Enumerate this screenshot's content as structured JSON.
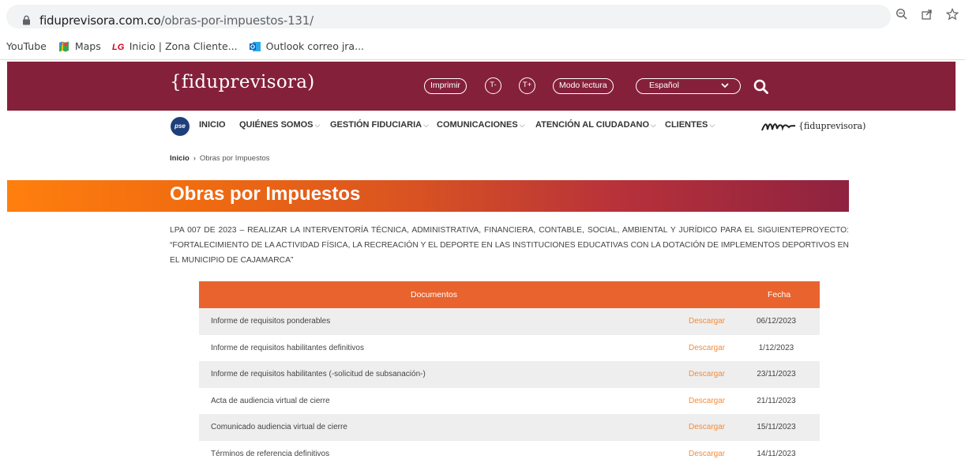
{
  "browser": {
    "url_host": "fiduprevisora.com.co",
    "url_path": "/obras-por-impuestos-131/",
    "icons": [
      "zoom-icon",
      "share-icon",
      "bookmark-star-icon"
    ]
  },
  "bookmarks": [
    {
      "label": "YouTube"
    },
    {
      "label": "Maps"
    },
    {
      "label": "Inicio | Zona Cliente..."
    },
    {
      "label": "Outlook correo jra..."
    }
  ],
  "header": {
    "logo": "{fiduprevisora)",
    "print_label": "Imprimir",
    "text_decrease": "T-",
    "text_increase": "T+",
    "reading_mode": "Modo lectura",
    "language": "Español",
    "colors": {
      "brand": "#85203b",
      "accent": "#e8632d"
    }
  },
  "nav": {
    "pse": "pse",
    "items": [
      "INICIO",
      "QUIÉNES SOMOS",
      "GESTIÓN FIDUCIARIA",
      "COMUNICACIONES",
      "ATENCIÓN AL CIUDADANO",
      "CLIENTES"
    ],
    "signature_text": "{fiduprevisora)"
  },
  "breadcrumb": {
    "home": "Inicio",
    "current": "Obras por Impuestos"
  },
  "page": {
    "title": "Obras por Impuestos",
    "description": "LPA 007 DE 2023 – REALIZAR LA INTERVENTORÍA TÉCNICA, ADMINISTRATIVA, FINANCIERA, CONTABLE, SOCIAL, AMBIENTAL Y JURÍDICO PARA EL SIGUIENTEPROYECTO: “FORTALECIMIENTO DE LA ACTIVIDAD FÍSICA, LA RECREACIÓN Y EL DEPORTE EN LAS INSTITUCIONES EDUCATIVAS CON LA DOTACIÓN DE IMPLEMENTOS DEPORTIVOS EN EL MUNICIPIO DE CAJAMARCA”"
  },
  "table": {
    "headers": {
      "documents": "Documentos",
      "date": "Fecha"
    },
    "rows": [
      {
        "name": "Informe de requisitos ponderables",
        "action": "Descargar",
        "date": "06/12/2023"
      },
      {
        "name": "Informe de requisitos habilitantes definitivos",
        "action": "Descargar",
        "date": "1/12/2023"
      },
      {
        "name": "Informe de requisitos habilitantes (-solicitud de subsanación-)",
        "action": "Descargar",
        "date": "23/11/2023"
      },
      {
        "name": "Acta de audiencia virtual de cierre",
        "action": "Descargar",
        "date": "21/11/2023"
      },
      {
        "name": "Comunicado audiencia virtual de cierre",
        "action": "Descargar",
        "date": "15/11/2023"
      },
      {
        "name": "Términos de referencia definitivos",
        "action": "Descargar",
        "date": "14/11/2023"
      }
    ]
  }
}
